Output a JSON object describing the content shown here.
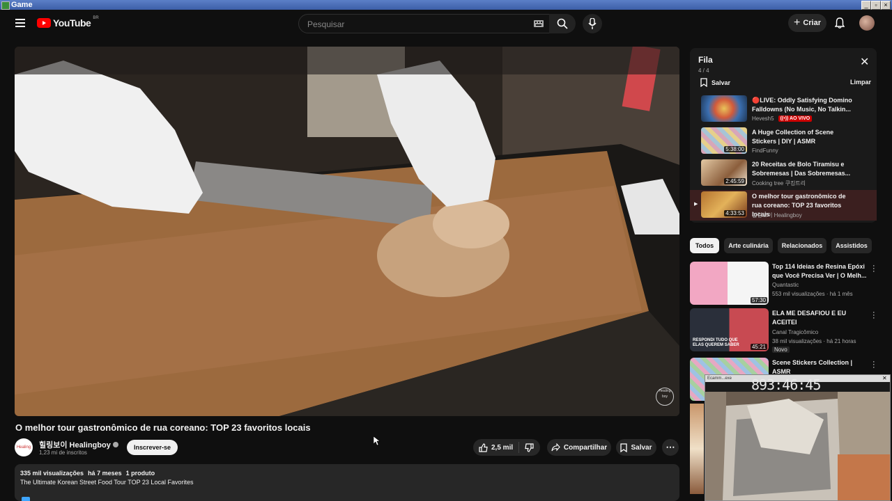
{
  "os": {
    "window_title": "Game"
  },
  "header": {
    "logo_text": "YouTube",
    "region": "BR",
    "search_placeholder": "Pesquisar",
    "create_label": "Criar"
  },
  "video": {
    "title": "O melhor tour gastronômico de rua coreano: TOP 23 favoritos locais",
    "channel": "힐링보이 Healingboy",
    "subscribers": "1,23 mi de inscritos",
    "subscribe_label": "Inscrever-se",
    "likes": "2,5 mil",
    "share_label": "Compartilhar",
    "save_label": "Salvar",
    "watermark": "Healing boy"
  },
  "description": {
    "views": "335 mil visualizações",
    "age": "há 7 meses",
    "products": "1 produto",
    "text": "The Ultimate Korean Street Food Tour TOP 23 Local Favorites"
  },
  "queue": {
    "title": "Fila",
    "position": "4 / 4",
    "save_label": "Salvar",
    "clear_label": "Limpar",
    "items": [
      {
        "title": "🔴LIVE: Oddly Satisfying Domino Falldowns (No Music, No Talkin...",
        "channel": "Hevesh5",
        "badge": "AO VIVO",
        "duration": ""
      },
      {
        "title": "A Huge Collection of Scene Stickers | DIY | ASMR",
        "channel": "FindFunny",
        "badge": "",
        "duration": "5:38:00"
      },
      {
        "title": "20 Receitas de Bolo Tiramisu e Sobremesas | Das Sobremesas...",
        "channel": "Cooking tree 쿠킹트리",
        "badge": "",
        "duration": "2:45:59"
      },
      {
        "title": "O melhor tour gastronômico de rua coreano: TOP 23 favoritos locais",
        "channel": "힐링보이 Healingboy",
        "badge": "",
        "duration": "4:33:53"
      }
    ]
  },
  "chips": [
    "Todos",
    "Arte culinária",
    "Relacionados",
    "Assistidos"
  ],
  "recommendations": [
    {
      "title": "Top 114 Ideias de Resina Epóxi que Você Precisa Ver | O Melh...",
      "channel": "Quantastic",
      "stats": "553 mil visualizações · há 1 mês",
      "duration": "57:30",
      "badge": ""
    },
    {
      "title": "ELA ME DESAFIOU E EU ACEITEI",
      "channel": "Canal Tragicômico",
      "stats": "38 mil visualizações · há 21 horas",
      "duration": "45:21",
      "badge": "Novo",
      "thumb_text": "RESPONDI TUDO QUE ELAS QUEREM SABER"
    },
    {
      "title": "Scene Stickers Collection | ASMR",
      "channel": "",
      "stats": "",
      "duration": "",
      "badge": ""
    }
  ],
  "overlay": {
    "timer": "893:46:45",
    "window_title": "Ecamm...exe"
  },
  "colors": {
    "bg": "#0f0f0f",
    "accent_red": "#ff0000",
    "surface": "#272727"
  }
}
